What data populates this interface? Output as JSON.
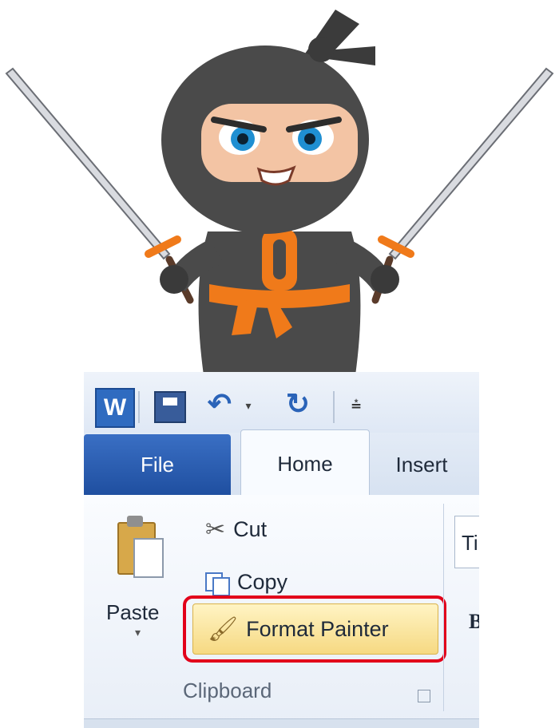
{
  "ribbon": {
    "tabs": {
      "file": "File",
      "home": "Home",
      "insert": "Insert"
    },
    "clipboard": {
      "cut": "Cut",
      "copy": "Copy",
      "paste": "Paste",
      "format_painter": "Format Painter",
      "group_label": "Clipboard"
    },
    "font_box_partial": "Ti",
    "font_bold_partial": "B"
  },
  "ninja": {
    "belt_letter": "O"
  },
  "colors": {
    "highlight": "#e2001a",
    "file_tab": "#2457b0",
    "ninja_suit": "#4a4a4a",
    "belt": "#f07a1a"
  },
  "icons": [
    "word-app-icon",
    "save-icon",
    "undo-icon",
    "redo-icon",
    "customize-qat-icon",
    "paste-icon",
    "cut-icon",
    "copy-icon",
    "format-painter-icon",
    "dialog-launcher-icon"
  ]
}
